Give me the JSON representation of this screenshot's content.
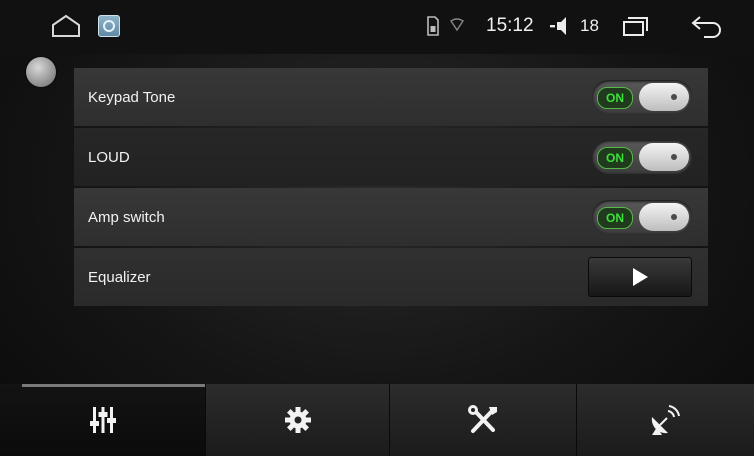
{
  "status_bar": {
    "time": "15:12",
    "volume_level": "18",
    "icons": [
      "home-icon",
      "app-tile-icon",
      "sim-card-icon",
      "wifi-icon",
      "volume-icon",
      "recent-apps-icon",
      "back-icon"
    ]
  },
  "settings": {
    "rows": [
      {
        "label": "Keypad Tone",
        "control": "toggle",
        "state": "ON"
      },
      {
        "label": "LOUD",
        "control": "toggle",
        "state": "ON"
      },
      {
        "label": "Amp switch",
        "control": "toggle",
        "state": "ON"
      },
      {
        "label": "Equalizer",
        "control": "play-button",
        "icon": "play-icon"
      }
    ]
  },
  "tabs": [
    {
      "icon": "equalizer-sliders-icon",
      "active": true
    },
    {
      "icon": "gear-icon",
      "active": false
    },
    {
      "icon": "tools-icon",
      "active": false
    },
    {
      "icon": "satellite-dish-icon",
      "active": false
    }
  ],
  "colors": {
    "toggle_on_text": "#3ce03a",
    "background": "#0d0d0d"
  }
}
